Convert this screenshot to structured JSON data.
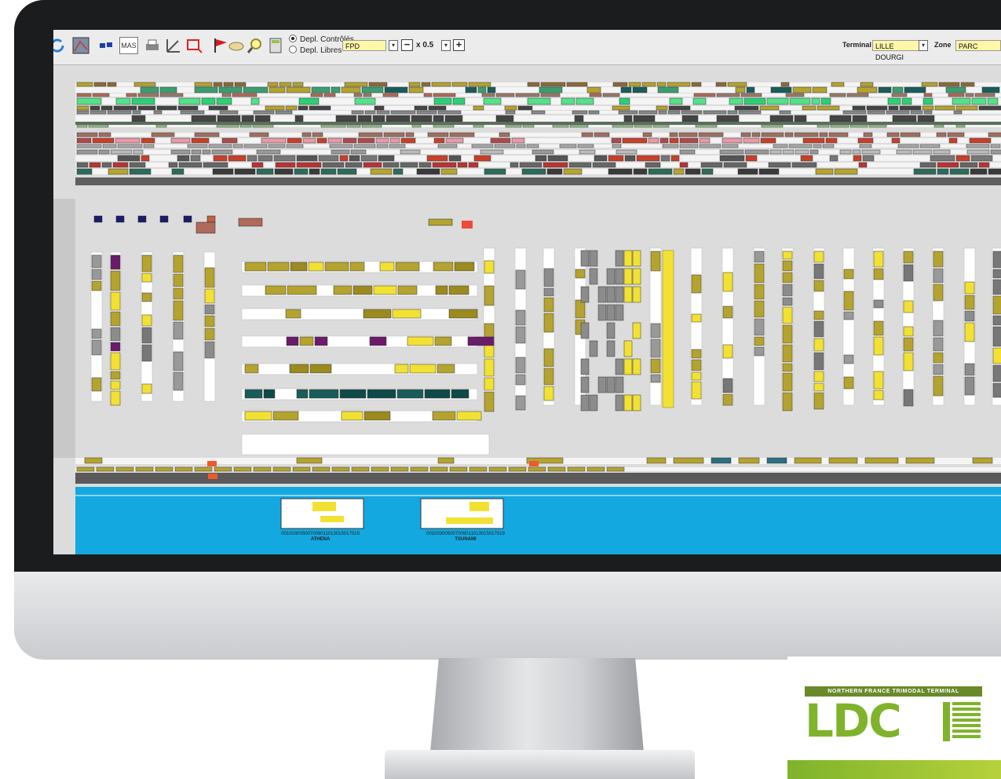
{
  "toolbar": {
    "mas_label": "MAS",
    "radio_controlled": "Depl. Contrôlés",
    "radio_free": "Depl. Libres",
    "mode_value": "FPD",
    "zoom_value": "x 0.5",
    "terminal_label": "Terminal",
    "terminal_value": "LILLE DOURGI",
    "zone_label": "Zone",
    "zone_value": "PARC"
  },
  "icons": [
    "refresh-icon",
    "map-icon",
    "flags-icon",
    "printer-icon",
    "measure-icon",
    "selection-icon",
    "red-flag-icon",
    "hand-icon",
    "magnifier-icon",
    "calculator-icon"
  ],
  "quay": {
    "vessel1": "ATHENA",
    "vessel2": "TSUNAMI",
    "ruler": "00100300500700901101301501701​9"
  },
  "logo": {
    "tagline": "NORTHERN FRANCE TRIMODAL TERMINAL",
    "name": "LDC"
  },
  "colors": {
    "olive": "#b5a330",
    "yellow": "#f2e133",
    "grey": "#8c8c8c",
    "teal": "#1a5c5a",
    "green": "#2ecf74",
    "red": "#c8402a",
    "pink": "#e89aa8",
    "water": "#14a8e0",
    "purple": "#6a1b6a",
    "brand_green": "#7fb32b"
  }
}
